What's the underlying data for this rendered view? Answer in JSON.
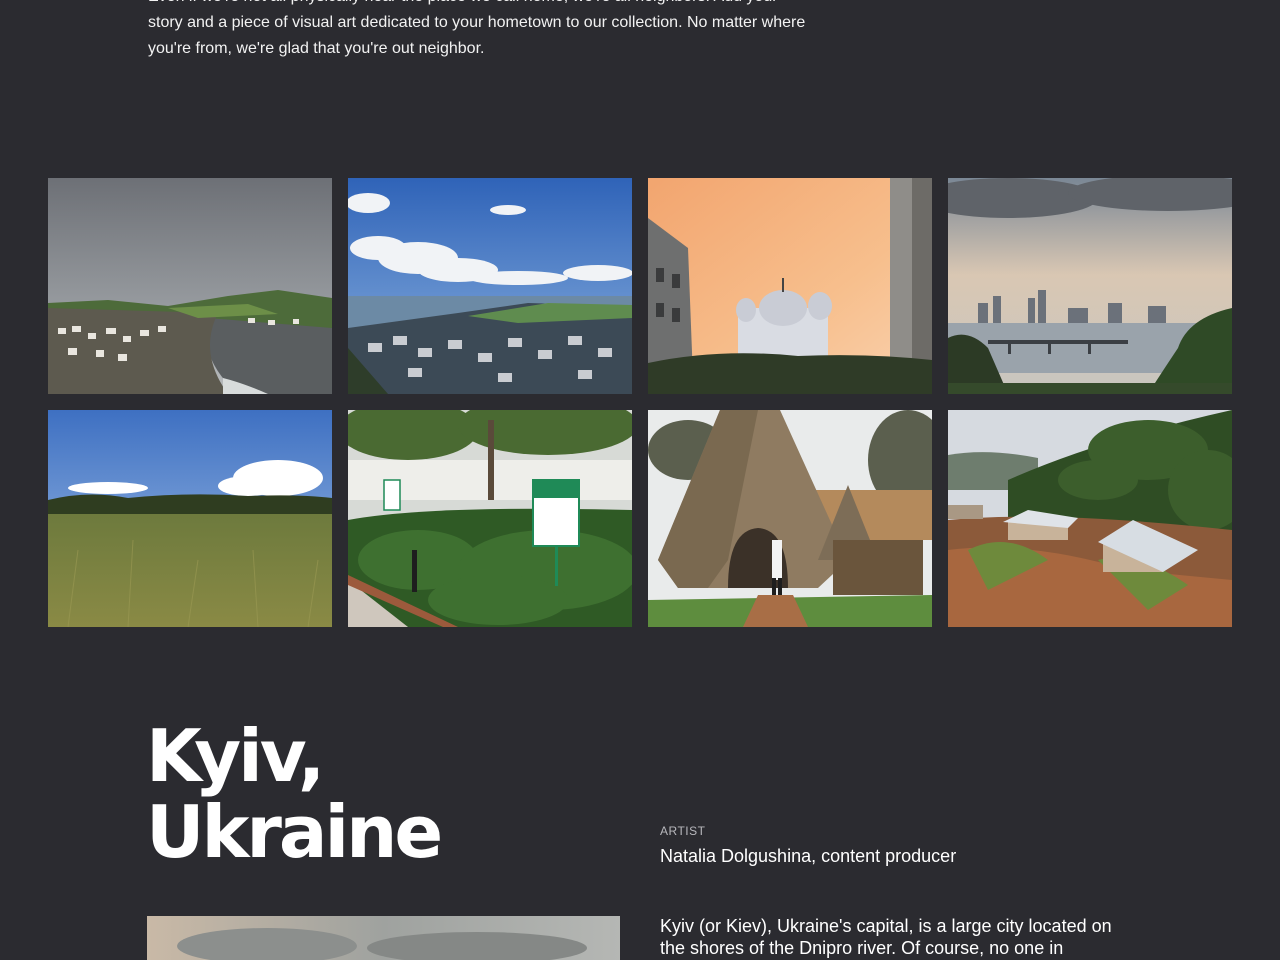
{
  "intro": {
    "line1": "Even if we're not all physically near the place we call home, we're all neighbors. Add your",
    "line2": "story and a piece of visual art dedicated to your hometown to our collection. No matter where",
    "line3": "you're from, we're glad that you're out neighbor."
  },
  "gallery": {
    "photos": [
      {
        "icon": "coastal-town-photo"
      },
      {
        "icon": "seaside-village-photo"
      },
      {
        "icon": "church-sunset-photo"
      },
      {
        "icon": "city-river-photo"
      },
      {
        "icon": "grass-field-photo"
      },
      {
        "icon": "garden-sign-photo"
      },
      {
        "icon": "thatched-hut-photo"
      },
      {
        "icon": "hillside-houses-photo"
      }
    ]
  },
  "feature": {
    "title_line1": "Kyiv,",
    "title_line2": "Ukraine",
    "artist_label": "ARTIST",
    "artist_name": "Natalia Dolgushina, content producer",
    "story": "Kyiv (or Kiev), Ukraine's capital, is a large city located on the shores of the Dnipro river. Of course, no one in"
  },
  "colors": {
    "background": "#2b2b30",
    "text": "#ffffff",
    "muted": "#b8b8bd"
  }
}
